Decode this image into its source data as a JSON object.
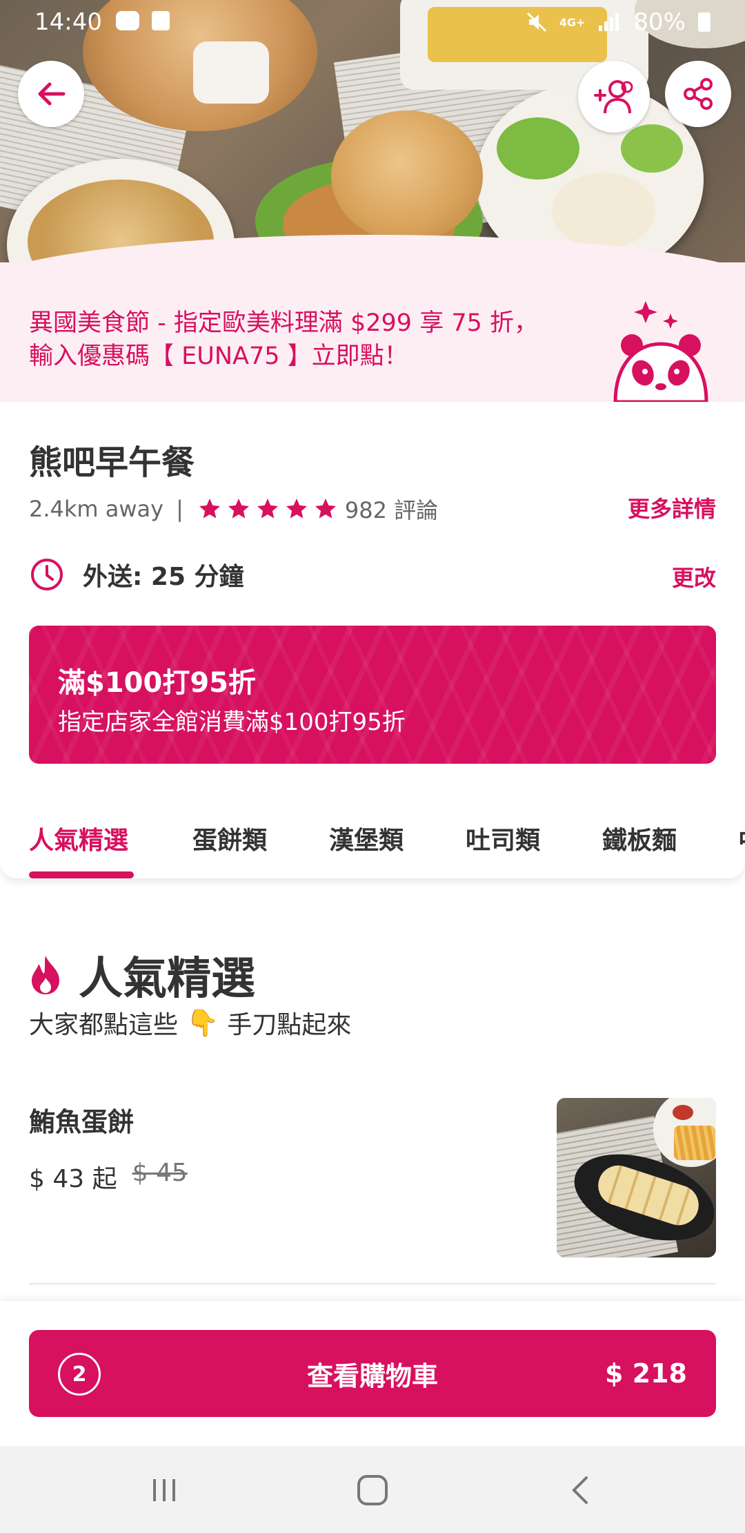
{
  "status_bar": {
    "time": "14:40",
    "battery": "80%"
  },
  "hero": {
    "back_icon": "arrow-left-icon",
    "group_icon": "group-order-icon",
    "share_icon": "share-icon"
  },
  "promo": {
    "line1": "異國美食節 - 指定歐美料理滿 $299 享 75 折，",
    "line2": "輸入優惠碼【 EUNA75 】立即點！"
  },
  "restaurant": {
    "name": "熊吧早午餐",
    "distance": "2.4km away",
    "separator": "|",
    "rating_stars": 5,
    "reviews": "982 評論",
    "more_details": "更多詳情"
  },
  "delivery": {
    "text": "外送: 25 分鐘",
    "change": "更改"
  },
  "deal": {
    "title": "滿$100打95折",
    "description": "指定店家全館消費滿$100打95折"
  },
  "tabs": [
    {
      "label": "人氣精選",
      "active": true
    },
    {
      "label": "蛋餅類"
    },
    {
      "label": "漢堡類"
    },
    {
      "label": "吐司類"
    },
    {
      "label": "鐵板麵"
    },
    {
      "label": "中"
    }
  ],
  "section": {
    "title": "人氣精選",
    "subtitle_part1": "大家都點這些",
    "subtitle_emoji": "👇",
    "subtitle_part2": "手刀點起來"
  },
  "menu_items": [
    {
      "name": "鮪魚蛋餅",
      "price": "$ 43 起",
      "original_price": "$ 45"
    }
  ],
  "cart": {
    "count": "2",
    "label": "查看購物車",
    "total": "$ 218"
  },
  "colors": {
    "brand": "#d7105f",
    "promo_bg": "#fdeef3"
  }
}
